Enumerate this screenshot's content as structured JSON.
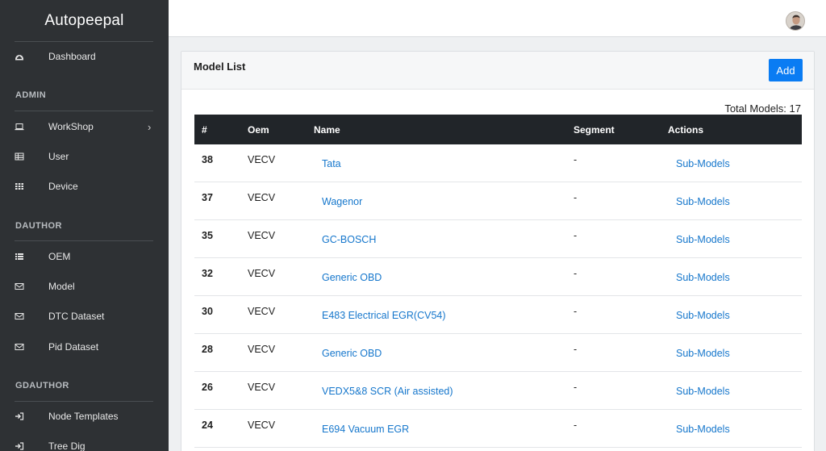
{
  "brand": "Autopeepal",
  "sidebar": {
    "items": [
      {
        "label": "Dashboard",
        "icon": "dashboard-icon"
      },
      {
        "label": "WorkShop",
        "icon": "laptop-icon",
        "has_chevron": true
      },
      {
        "label": "User",
        "icon": "table-icon"
      },
      {
        "label": "Device",
        "icon": "grid-icon"
      },
      {
        "label": "OEM",
        "icon": "list-icon"
      },
      {
        "label": "Model",
        "icon": "envelope-icon"
      },
      {
        "label": "DTC Dataset",
        "icon": "envelope-icon"
      },
      {
        "label": "Pid Dataset",
        "icon": "envelope-icon"
      },
      {
        "label": "Node Templates",
        "icon": "sign-in-icon"
      },
      {
        "label": "Tree Dig",
        "icon": "sign-in-icon"
      }
    ],
    "sections": {
      "admin": "ADMIN",
      "dauthor": "DAUTHOR",
      "gdauthor": "GDAUTHOR"
    },
    "chevron": "›"
  },
  "card": {
    "title": "Model List",
    "add_label": "Add",
    "total_label": "Total Models: 17"
  },
  "table": {
    "headers": [
      "#",
      "Oem",
      "Name",
      "Segment",
      "Actions"
    ],
    "rows": [
      {
        "num": "38",
        "oem": "VECV",
        "name": "Tata",
        "segment": "-",
        "action": "Sub-Models"
      },
      {
        "num": "37",
        "oem": "VECV",
        "name": "Wagenor",
        "segment": "-",
        "action": "Sub-Models"
      },
      {
        "num": "35",
        "oem": "VECV",
        "name": "GC-BOSCH",
        "segment": "-",
        "action": "Sub-Models"
      },
      {
        "num": "32",
        "oem": "VECV",
        "name": "Generic OBD",
        "segment": "-",
        "action": "Sub-Models"
      },
      {
        "num": "30",
        "oem": "VECV",
        "name": "E483 Electrical EGR(CV54)",
        "segment": "-",
        "action": "Sub-Models"
      },
      {
        "num": "28",
        "oem": "VECV",
        "name": "Generic OBD",
        "segment": "-",
        "action": "Sub-Models"
      },
      {
        "num": "26",
        "oem": "VECV",
        "name": "VEDX5&8 SCR (Air assisted)",
        "segment": "-",
        "action": "Sub-Models"
      },
      {
        "num": "24",
        "oem": "VECV",
        "name": "E694 Vacuum EGR",
        "segment": "-",
        "action": "Sub-Models"
      }
    ]
  },
  "colors": {
    "sidebar_bg": "#2e3134",
    "accent": "#0a7cf3",
    "link": "#1677cc",
    "table_header_bg": "#212529"
  }
}
